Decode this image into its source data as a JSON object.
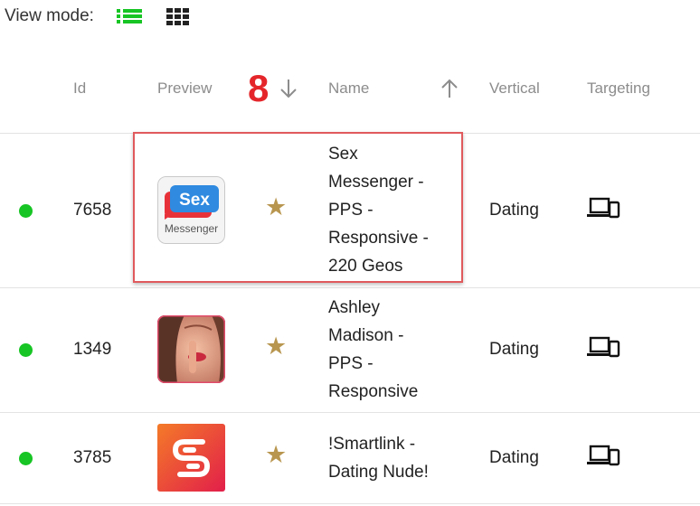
{
  "view_mode": {
    "label": "View mode:",
    "options": [
      {
        "name": "list",
        "icon": "list-icon",
        "active": true,
        "color": "#17c524"
      },
      {
        "name": "grid",
        "icon": "grid-icon",
        "active": false,
        "color": "#222222"
      }
    ]
  },
  "annotation": {
    "label": "8",
    "color": "#e4262b"
  },
  "table": {
    "columns": {
      "id": "Id",
      "preview": "Preview",
      "name": "Name",
      "vertical": "Vertical",
      "targeting": "Targeting"
    },
    "rows": [
      {
        "status": "active",
        "status_color": "#17c524",
        "id": "7658",
        "preview_icon": "sex-messenger-logo",
        "preview_text": [
          "Sex",
          "Messenger"
        ],
        "favorite_icon": "star-icon",
        "name": [
          "Sex",
          "Messenger -",
          "PPS -",
          "Responsive -",
          "220 Geos"
        ],
        "vertical": "Dating",
        "targeting_icon": "devices-icon",
        "highlighted": true
      },
      {
        "status": "active",
        "status_color": "#17c524",
        "id": "1349",
        "preview_icon": "ashley-madison-photo",
        "favorite_icon": "star-icon",
        "name": [
          "Ashley",
          "Madison -",
          "PPS -",
          "Responsive"
        ],
        "vertical": "Dating",
        "targeting_icon": "devices-icon",
        "highlighted": false
      },
      {
        "status": "active",
        "status_color": "#17c524",
        "id": "3785",
        "preview_icon": "smartlink-logo",
        "favorite_icon": "star-icon",
        "name": [
          "!Smartlink -",
          "Dating Nude!"
        ],
        "vertical": "Dating",
        "targeting_icon": "devices-icon",
        "highlighted": false
      }
    ]
  },
  "colors": {
    "highlight_border": "#e05a5c",
    "star": "#b8964f",
    "status_active": "#17c524"
  }
}
